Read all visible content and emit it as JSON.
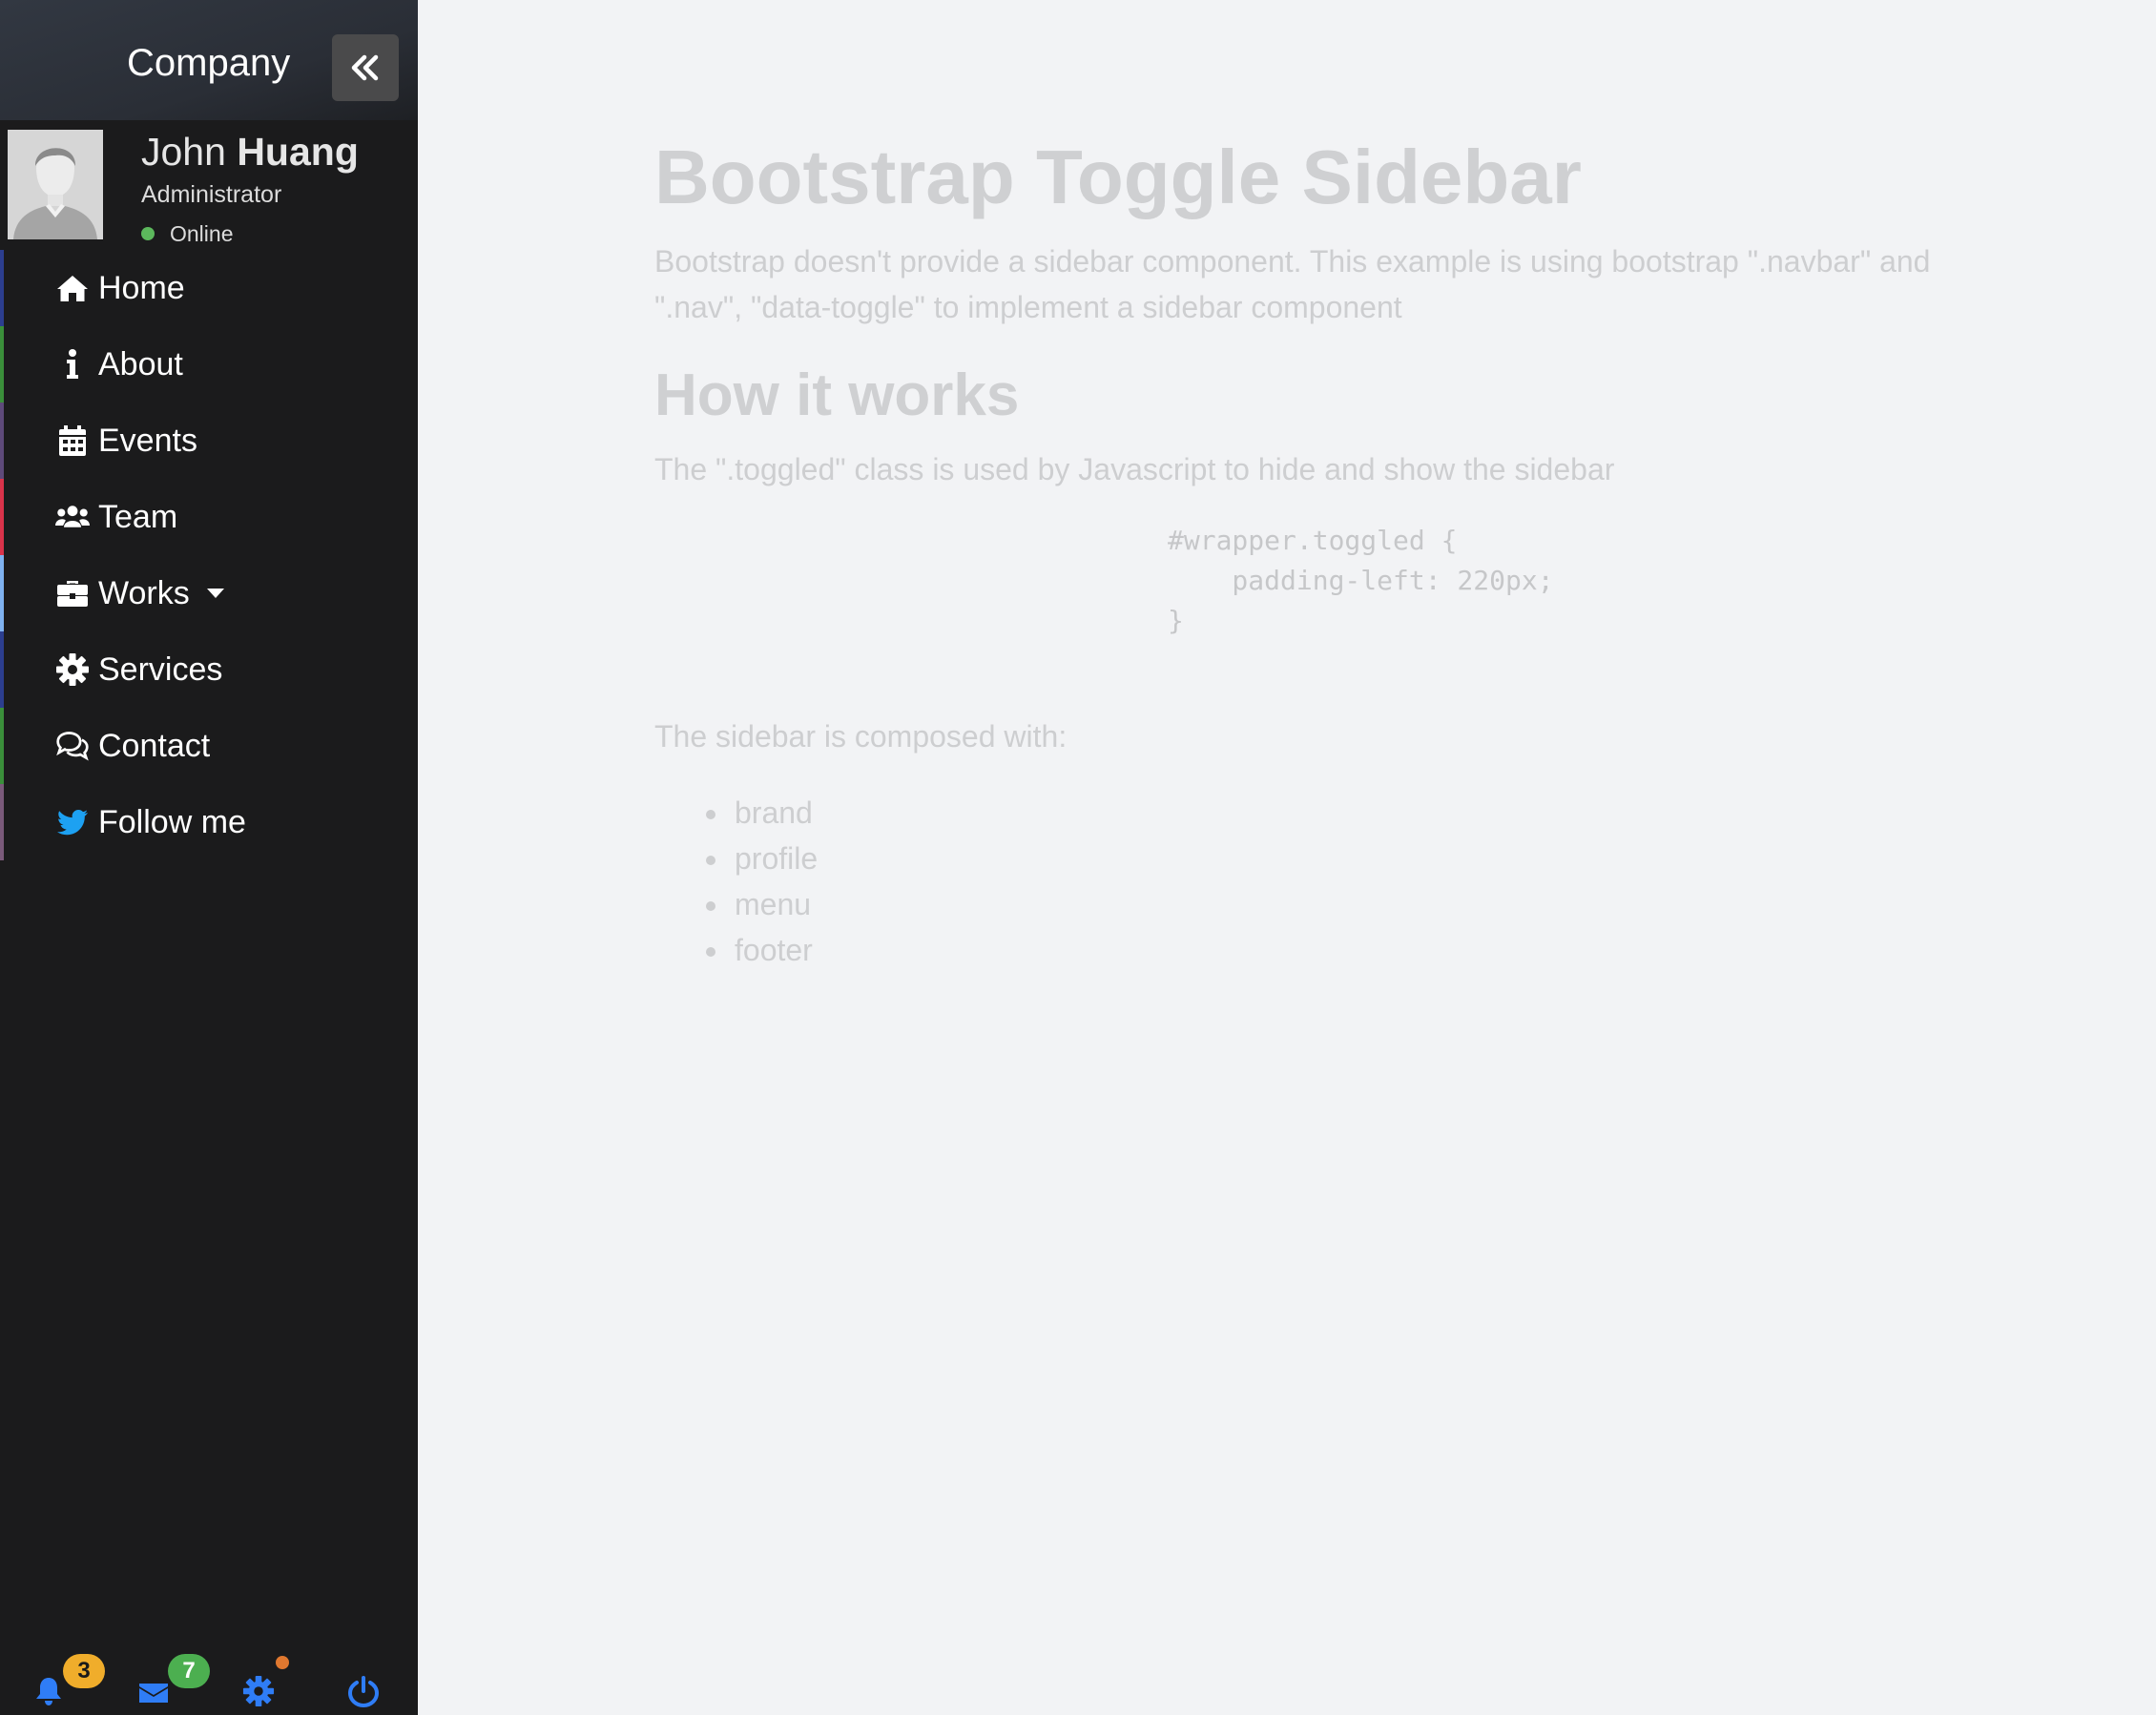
{
  "sidebar": {
    "brand": "Company",
    "user": {
      "first_name": "John",
      "last_name": "Huang",
      "role": "Administrator",
      "status": "Online"
    },
    "menu": [
      {
        "label": "Home",
        "icon": "home-icon",
        "accent": "#2c3e8f"
      },
      {
        "label": "About",
        "icon": "info-icon",
        "accent": "#3a8f3a"
      },
      {
        "label": "Events",
        "icon": "calendar-icon",
        "accent": "#5e4a7a"
      },
      {
        "label": "Team",
        "icon": "users-icon",
        "accent": "#d9334a"
      },
      {
        "label": "Works",
        "icon": "briefcase-icon",
        "accent": "#7fb2f0",
        "dropdown": true
      },
      {
        "label": "Services",
        "icon": "gear-icon",
        "accent": "#2c3e8f"
      },
      {
        "label": "Contact",
        "icon": "comments-icon",
        "accent": "#3a8f3a"
      },
      {
        "label": "Follow me",
        "icon": "twitter-icon",
        "accent": "#7a5a7a"
      }
    ],
    "footer": {
      "notifications_count": "3",
      "messages_count": "7"
    }
  },
  "main": {
    "title": "Bootstrap Toggle Sidebar",
    "intro": "Bootstrap doesn't provide a sidebar component. This example is using bootstrap \".navbar\" and \".nav\", \"data-toggle\" to implement a sidebar component",
    "how_heading": "How it works",
    "how_desc": "The \".toggled\" class is used by Javascript to hide and show the sidebar",
    "code": "#wrapper.toggled {\n    padding-left: 220px;\n}",
    "composed_label": "The sidebar is composed with:",
    "parts": [
      "brand",
      "profile",
      "menu",
      "footer"
    ]
  },
  "colors": {
    "sidebar_bg": "#1b1b1c",
    "main_bg": "#f2f3f5",
    "footer_icon": "#2f7df6",
    "status_online": "#5cb85c"
  }
}
